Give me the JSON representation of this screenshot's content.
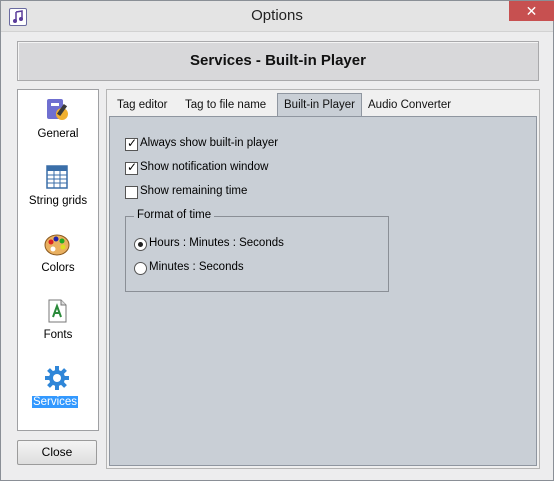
{
  "window": {
    "title": "Options",
    "close_glyph": "✕"
  },
  "header": {
    "title": "Services - Built-in Player"
  },
  "sidebar": {
    "items": [
      {
        "label": "General",
        "icon": "general-icon",
        "selected": false
      },
      {
        "label": "String grids",
        "icon": "grid-icon",
        "selected": false
      },
      {
        "label": "Colors",
        "icon": "palette-icon",
        "selected": false
      },
      {
        "label": "Fonts",
        "icon": "font-icon",
        "selected": false
      },
      {
        "label": "Services",
        "icon": "gear-icon",
        "selected": true
      }
    ]
  },
  "tabs": [
    {
      "label": "Tag editor",
      "active": false
    },
    {
      "label": "Tag to file name",
      "active": false
    },
    {
      "label": "Built-in Player",
      "active": true
    },
    {
      "label": "Audio Converter",
      "active": false
    }
  ],
  "options": [
    {
      "label": "Always show built-in player",
      "checked": true
    },
    {
      "label": "Show notification window",
      "checked": true
    },
    {
      "label": "Show remaining time",
      "checked": false
    }
  ],
  "format_group": {
    "title": "Format of time",
    "choices": [
      {
        "label": "Hours : Minutes : Seconds",
        "selected": true
      },
      {
        "label": "Minutes : Seconds",
        "selected": false
      }
    ]
  },
  "footer": {
    "close_label": "Close"
  },
  "colors": {
    "selection": "#3399ff",
    "close_button": "#c75050",
    "panel": "#c9cfd6"
  }
}
